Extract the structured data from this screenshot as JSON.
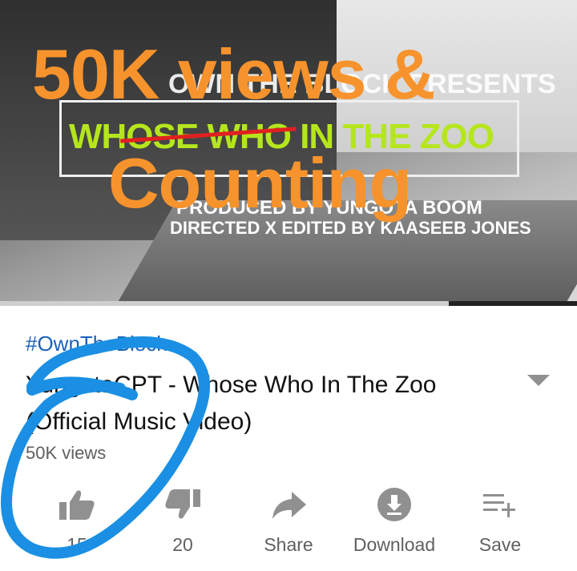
{
  "video": {
    "overlay_line1": "50K views &",
    "overlay_line2": "Counting",
    "clip_presents": "OWN THE BLOCK PRESENTS",
    "clip_title": "WHOSE WHO IN THE ZOO",
    "clip_produced": "PRODUCED BY YUNGOTA BOOM",
    "clip_directed": "DIRECTED X EDITED BY KAASEEB JONES",
    "progress_fraction": 0.0,
    "colors": {
      "overlay": "#f7932c",
      "clip_title": "#b5e61d",
      "progress": "#e62117"
    }
  },
  "info": {
    "hashtag": "#OwnTheBlock",
    "title": "YungotaCPT - Whose Who In The Zoo (Official Music Video)",
    "views": "50K views",
    "expand_icon": "chevron-down-icon"
  },
  "actions": [
    {
      "id": "like",
      "icon": "thumbs-up-icon",
      "label": "15"
    },
    {
      "id": "dislike",
      "icon": "thumbs-down-icon",
      "label": "20"
    },
    {
      "id": "share",
      "icon": "share-icon",
      "label": "Share"
    },
    {
      "id": "download",
      "icon": "download-icon",
      "label": "Download"
    },
    {
      "id": "save",
      "icon": "playlist-add-icon",
      "label": "Save"
    }
  ],
  "annotation": {
    "color": "#1a8fe3"
  }
}
